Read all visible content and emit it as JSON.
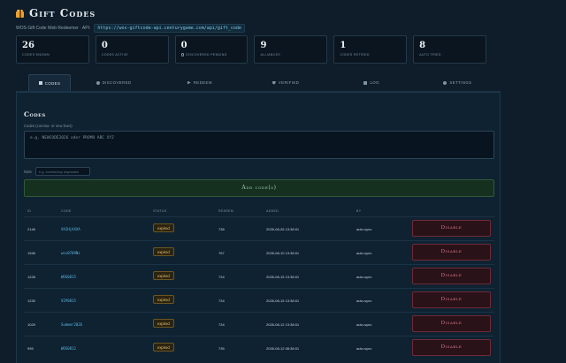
{
  "app": {
    "title": "Gift Codes",
    "subtitle": "WOS Gift Code Web Redeemer · API:",
    "api_url": "https://wos-giftcode-api.centurygame.com/api/gift_code"
  },
  "stats": [
    {
      "value": "26",
      "label": "Codes Known"
    },
    {
      "value": "0",
      "label": "Codes Active"
    },
    {
      "value": "0",
      "label": "Discovered Pending"
    },
    {
      "value": "9",
      "label": "Alliances"
    },
    {
      "value": "1",
      "label": "Codes Retried"
    },
    {
      "value": "8",
      "label": "Auto Tried"
    }
  ],
  "tabs": [
    {
      "label": "Codes",
      "icon": "codes-icon"
    },
    {
      "label": "Discovered",
      "icon": "search-icon"
    },
    {
      "label": "Redeem",
      "icon": "play-icon"
    },
    {
      "label": "Verified",
      "icon": "shield-icon"
    },
    {
      "label": "Log",
      "icon": "log-icon"
    },
    {
      "label": "Settings",
      "icon": "gear-icon"
    }
  ],
  "form": {
    "section_title": "Codes",
    "codes_label": "Codes (comma- or new lines)",
    "codes_placeholder": "e.g. NEWCODE2026 oder PROMO ABC XYZ",
    "note_label": "Note",
    "note_placeholder": "e.g. events/any day/sales",
    "add_label": "Add code(s)"
  },
  "table": {
    "headers": {
      "id": "ID",
      "code": "Code",
      "status": "Status",
      "redeemed": "Redeem",
      "added": "Added",
      "by": "By",
      "actions": ""
    },
    "disable_label": "Disable",
    "rows": [
      {
        "id": "2146",
        "code": "VA2HjAXXA",
        "status": "expired",
        "redeemed": "738",
        "added": "2026-08-26 13:38:01",
        "by": "auto-sync"
      },
      {
        "id": "1946",
        "code": "wos0709Ns",
        "status": "expired",
        "redeemed": "767",
        "added": "2026-08-10 13:38:01",
        "by": "auto-sync"
      },
      {
        "id": "1228",
        "code": "WOS0815",
        "status": "expired",
        "redeemed": "734",
        "added": "2026-08-15 13:38:01",
        "by": "auto-sync"
      },
      {
        "id": "1230",
        "code": "VIP0815",
        "status": "expired",
        "redeemed": "734",
        "added": "2026-08-15 13:38:01",
        "by": "auto-sync"
      },
      {
        "id": "1029",
        "code": "Summer2026",
        "status": "expired",
        "redeemed": "734",
        "added": "2026-08-12 13:38:01",
        "by": "auto-sync"
      },
      {
        "id": "995",
        "code": "WOS0812",
        "status": "expired",
        "redeemed": "735",
        "added": "2026-08-12 08:38:01",
        "by": "auto-sync"
      }
    ]
  }
}
